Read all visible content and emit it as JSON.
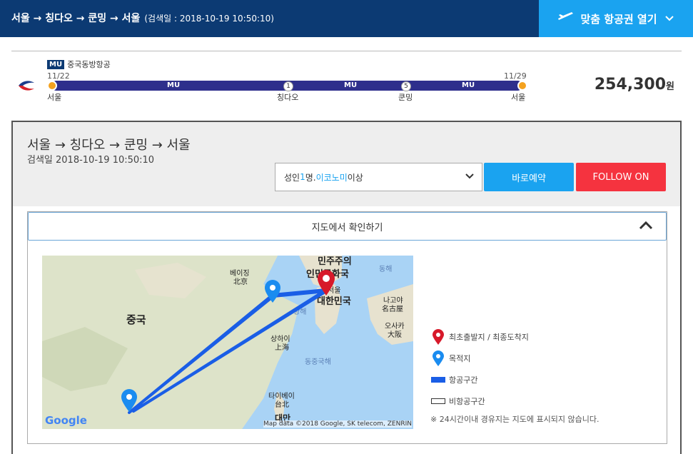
{
  "header": {
    "route": "서울 → 칭다오 → 쿤밍 → 서울",
    "search_time": "(검색일 : 2018-10-19 10:50:10)",
    "open_button": "맞춤 항공권 열기"
  },
  "itinerary": {
    "carrier_code": "MU",
    "carrier_name": "중국동방항공",
    "date_start": "11/22",
    "date_end": "11/29",
    "segments": [
      "MU",
      "MU",
      "MU"
    ],
    "stops": [
      {
        "city": "서울"
      },
      {
        "city": "칭다오",
        "days": "1"
      },
      {
        "city": "쿤밍",
        "days": "5"
      },
      {
        "city": "서울"
      }
    ],
    "price": "254,300",
    "price_unit": "원"
  },
  "detail": {
    "title": "서울 → 칭다오 → 쿤밍 → 서울",
    "search_time": "검색일 2018-10-19 10:50:10",
    "select": {
      "prefix": "성인 ",
      "count": "1",
      "mid": "명. ",
      "cabin": "이코노미",
      "suffix": " 이상"
    },
    "book_button": "바로예약",
    "follow_button": "FOLLOW ON"
  },
  "map": {
    "toggle_label": "지도에서 확인하기",
    "labels": {
      "dprk": "민주주의 인민공화국",
      "beijing": "베이징 北京",
      "china": "중국",
      "seoul": "서울",
      "korea": "대한민국",
      "east_sea": "동해",
      "yellow_sea": "황해",
      "nagoya": "나고야 名古屋",
      "osaka": "오사카 大阪",
      "shanghai": "상하이 上海",
      "ecs": "동중국해",
      "taipei": "타이베이 台北",
      "taiwan": "대만"
    },
    "google": "Google",
    "copyright": "Map data ©2018 Google, SK telecom, ZENRIN"
  },
  "legend": {
    "origin": "최초출발지 / 최종도착지",
    "destination": "목적지",
    "flight": "항공구간",
    "non_flight": "비항공구간",
    "note": "※ 24시간이내 경유지는 지도에 표시되지 않습니다."
  },
  "colors": {
    "header": "#0c3a73",
    "accent": "#1aa3f0",
    "follow": "#f5333f",
    "track": "#2e2f8c",
    "route": "#1a5ee6"
  }
}
